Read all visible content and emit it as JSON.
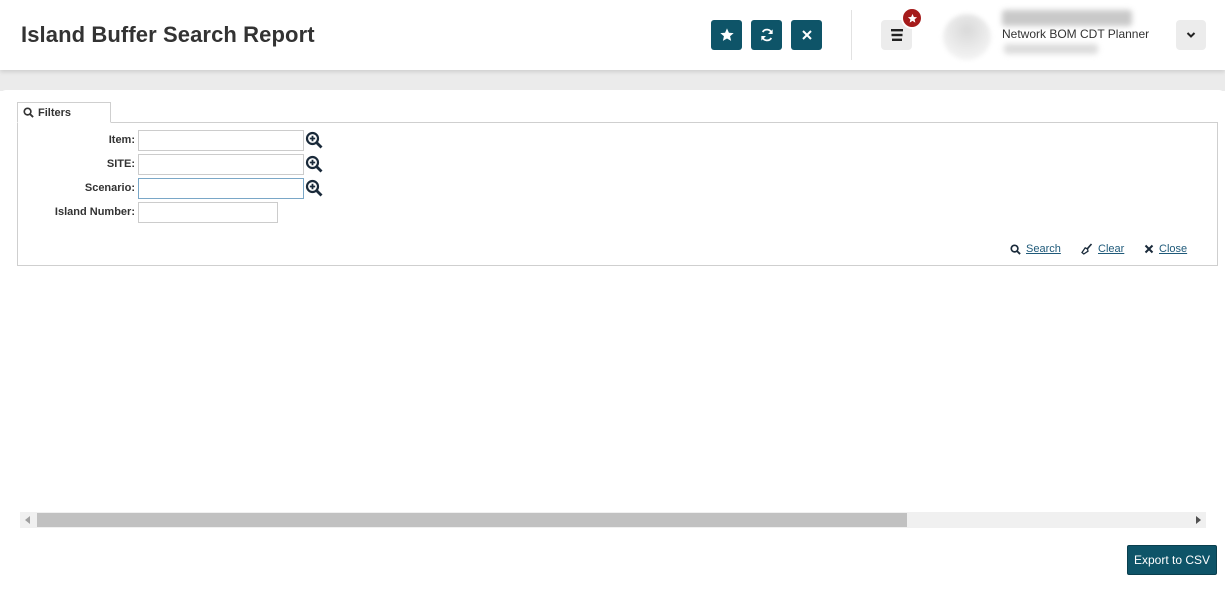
{
  "header": {
    "title": "Island Buffer Search Report",
    "actions": [
      {
        "name": "favorite",
        "icon": "star-icon"
      },
      {
        "name": "refresh",
        "icon": "refresh-icon"
      },
      {
        "name": "close",
        "icon": "close-icon"
      }
    ],
    "menu_icon": "hamburger-menu-icon",
    "favorites_badge_icon": "star-icon",
    "user": {
      "role": "Network BOM CDT Planner"
    }
  },
  "filters": {
    "tab_label": "Filters",
    "fields": [
      {
        "label": "Item:",
        "value": "",
        "lookup": true
      },
      {
        "label": "SITE:",
        "value": "",
        "lookup": true
      },
      {
        "label": "Scenario:",
        "value": "",
        "lookup": true
      },
      {
        "label": "Island Number:",
        "value": "",
        "lookup": false
      }
    ],
    "actions": {
      "search": "Search",
      "clear": "Clear",
      "close": "Close"
    }
  },
  "footer": {
    "export_label": "Export to CSV"
  },
  "colors": {
    "accent": "#0e5468",
    "badge": "#a51b1b",
    "link": "#1f5a7a"
  }
}
